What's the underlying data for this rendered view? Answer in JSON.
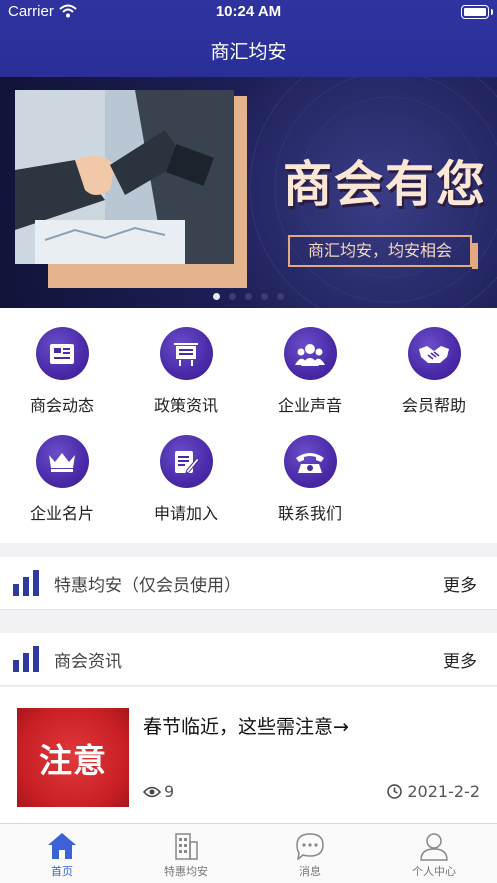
{
  "status_bar": {
    "carrier": "Carrier",
    "time": "10:24 AM"
  },
  "nav": {
    "title": "商汇均安"
  },
  "banner": {
    "headline": "商会有您",
    "tagline": "商汇均安，均安相会",
    "page_count": 5,
    "active_page": 1
  },
  "menu": [
    {
      "label": "商会动态",
      "icon": "news-card-icon"
    },
    {
      "label": "政策资讯",
      "icon": "board-icon"
    },
    {
      "label": "企业声音",
      "icon": "people-group-icon"
    },
    {
      "label": "会员帮助",
      "icon": "handshake-icon"
    },
    {
      "label": "企业名片",
      "icon": "crown-icon"
    },
    {
      "label": "申请加入",
      "icon": "edit-note-icon"
    },
    {
      "label": "联系我们",
      "icon": "telephone-icon"
    }
  ],
  "sections": {
    "special": {
      "title": "特惠均安（仅会员使用）",
      "more": "更多"
    },
    "news": {
      "title": "商会资讯",
      "more": "更多"
    }
  },
  "news_items": [
    {
      "thumb_text": "注意",
      "title": "春节临近，这些需注意→",
      "views": "9",
      "date": "2021-2-2"
    }
  ],
  "tabbar": [
    {
      "label": "首页",
      "icon": "home-icon",
      "active": true
    },
    {
      "label": "特惠均安",
      "icon": "building-icon",
      "active": false
    },
    {
      "label": "消息",
      "icon": "chat-bubble-icon",
      "active": false
    },
    {
      "label": "个人中心",
      "icon": "person-icon",
      "active": false
    }
  ],
  "colors": {
    "nav_bg": "#2f33a0",
    "accent_purple": "#4a2aa8",
    "tab_active": "#3b62d6",
    "section_bars": "#2f3aa0"
  }
}
